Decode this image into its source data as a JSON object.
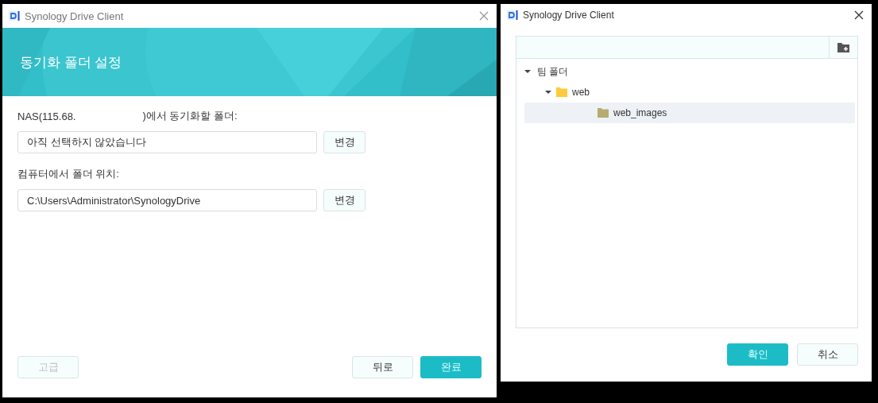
{
  "setup_window": {
    "title": "Synology Drive Client",
    "banner_title": "동기화 폴더 설정",
    "nas_label": {
      "prefix": "NAS(115.68.",
      "suffix": ")에서 동기화할 폴더:"
    },
    "nas_folder": {
      "value": "아직 선택하지 않았습니다",
      "button": "변경"
    },
    "local_label": "컴퓨터에서 폴더 위치:",
    "local_folder": {
      "value": "C:\\Users\\Administrator\\SynologyDrive",
      "button": "변경"
    },
    "buttons": [
      {
        "label": "고급",
        "kind": "secondary",
        "disabled": true
      },
      {
        "label": "뒤로",
        "kind": "secondary",
        "disabled": false
      },
      {
        "label": "완료",
        "kind": "primary",
        "disabled": false
      }
    ]
  },
  "folder_window": {
    "title": "Synology Drive Client",
    "tree": [
      {
        "label": "팀 폴더",
        "expanded": true,
        "selected": false,
        "children": [
          {
            "label": "web",
            "kind": "folder",
            "expanded": true,
            "selected": false,
            "children": [
              {
                "label": "web_images",
                "kind": "folder",
                "selected": true
              }
            ]
          }
        ]
      }
    ],
    "buttons": [
      {
        "label": "확인",
        "kind": "primary",
        "disabled": false
      },
      {
        "label": "취소",
        "kind": "secondary",
        "disabled": false
      }
    ]
  }
}
